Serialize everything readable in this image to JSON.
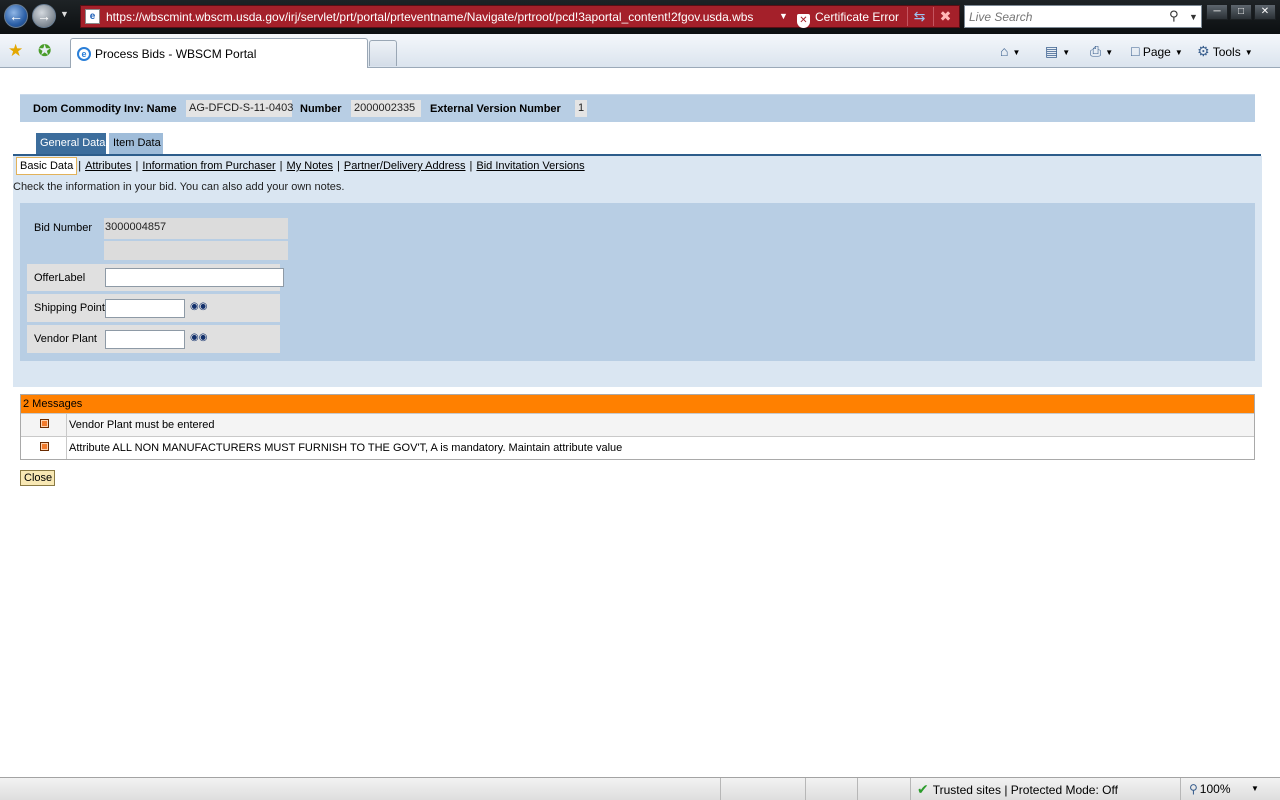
{
  "browser": {
    "url": "https://wbscmint.wbscm.usda.gov/irj/servlet/prt/portal/prteventname/Navigate/prtroot/pcd!3aportal_content!2fgov.usda.wbs",
    "certificate_error": "Certificate Error",
    "search_placeholder": "Live Search",
    "tab_title": "Process Bids - WBSCM Portal",
    "page_menu": "Page",
    "tools_menu": "Tools",
    "status_zone": "Trusted sites | Protected Mode: Off",
    "zoom": "100%"
  },
  "header": {
    "name_label": "Dom Commodity Inv: Name",
    "name_value": "AG-DFCD-S-11-0403",
    "number_label": "Number",
    "number_value": "2000002335",
    "ext_label": "External Version Number",
    "ext_value": "1"
  },
  "tabs": [
    {
      "label": "General Data",
      "active": true
    },
    {
      "label": "Item Data",
      "active": false
    }
  ],
  "subtabs": [
    {
      "label": "Basic Data",
      "active": true
    },
    {
      "label": "Attributes"
    },
    {
      "label": "Information from Purchaser"
    },
    {
      "label": "My Notes"
    },
    {
      "label": "Partner/Delivery Address"
    },
    {
      "label": "Bid Invitation Versions"
    }
  ],
  "panel_hint": "Check the information in your bid. You can also add your own notes.",
  "form": {
    "bid_number_label": "Bid Number",
    "bid_number_value": "3000004857",
    "offer_label": "OfferLabel",
    "offer_value": "",
    "shipping_label": "Shipping Point",
    "shipping_value": "",
    "vendor_label": "Vendor Plant",
    "vendor_value": ""
  },
  "messages": {
    "header": "2 Messages",
    "items": [
      "Vendor Plant must be entered",
      "Attribute ALL NON MANUFACTURERS MUST FURNISH TO THE GOV'T, A is mandatory. Maintain attribute value"
    ]
  },
  "close_label": "Close",
  "colors": {
    "header_bar": "#b8cee4",
    "active_tab": "#3c6d9c",
    "panel": "#dae6f2",
    "messages_header": "#ff8000",
    "address_error": "#a4202a"
  }
}
